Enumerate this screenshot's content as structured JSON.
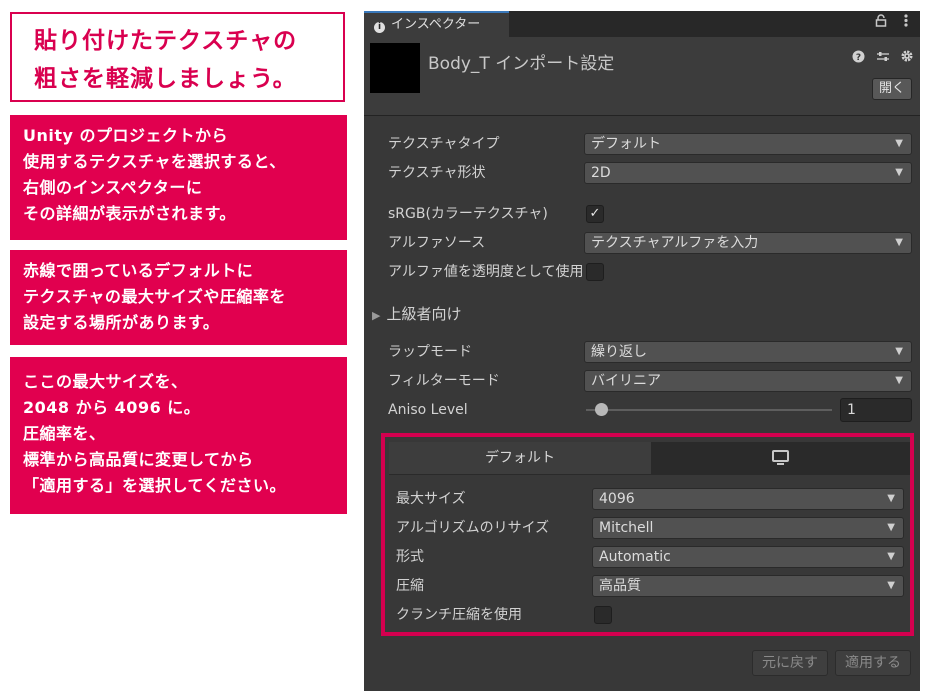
{
  "left_panel": {
    "title_lines": [
      "貼り付けたテクスチャの",
      "粗さを軽減しましょう。"
    ],
    "note1_lines": [
      "Unity のプロジェクトから",
      "使用するテクスチャを選択すると、",
      "右側のインスペクターに",
      "その詳細が表示がされます。"
    ],
    "note2_lines": [
      "赤線で囲っているデフォルトに",
      "テクスチャの最大サイズや圧縮率を",
      "設定する場所があります。"
    ],
    "note3_lines": [
      "ここの最大サイズを、",
      "2048 から 4096 に。",
      "圧縮率を、",
      "標準から高品質に変更してから",
      "「適用する」を選択してください。"
    ],
    "colors": {
      "accent": "#e1004f",
      "text_on_accent": "#ffffff"
    }
  },
  "inspector": {
    "tab": {
      "info_symbol": "i",
      "label": "インスペクター",
      "lock_icon": "lock-icon",
      "menu_icon": "kebab-menu-icon"
    },
    "header": {
      "title": "Body_T インポート設定",
      "help_icon": "help-icon",
      "preset_icon": "preset-sliders-icon",
      "settings_icon": "gear-icon",
      "open_button": "開く"
    },
    "fields": {
      "texture_type": {
        "label": "テクスチャタイプ",
        "value": "デフォルト"
      },
      "texture_shape": {
        "label": "テクスチャ形状",
        "value": "2D"
      },
      "srgb": {
        "label": "sRGB(カラーテクスチャ)",
        "checked": true,
        "check_glyph": "✓"
      },
      "alpha_source": {
        "label": "アルファソース",
        "value": "テクスチャアルファを入力"
      },
      "alpha_is_transparency": {
        "label": "アルファ値を透明度として使用",
        "checked": false
      },
      "advanced": {
        "label": "上級者向け",
        "expanded": false,
        "arrow": "▶"
      },
      "wrap_mode": {
        "label": "ラップモード",
        "value": "繰り返し"
      },
      "filter_mode": {
        "label": "フィルターモード",
        "value": "バイリニア"
      },
      "aniso_level": {
        "label": "Aniso Level",
        "value": "1",
        "slider_fraction": 0.0625
      }
    },
    "platform": {
      "tabs": {
        "default_label": "デフォルト",
        "standalone_icon": "monitor-icon"
      },
      "max_size": {
        "label": "最大サイズ",
        "value": "4096"
      },
      "resize_algorithm": {
        "label": "アルゴリズムのリサイズ",
        "value": "Mitchell"
      },
      "format": {
        "label": "形式",
        "value": "Automatic"
      },
      "compression": {
        "label": "圧縮",
        "value": "高品質"
      },
      "crunch": {
        "label": "クランチ圧縮を使用",
        "checked": false
      },
      "highlight_color": "#d4004f"
    },
    "footer": {
      "revert": "元に戻す",
      "apply": "適用する"
    },
    "dropdown_arrow": "▼"
  }
}
